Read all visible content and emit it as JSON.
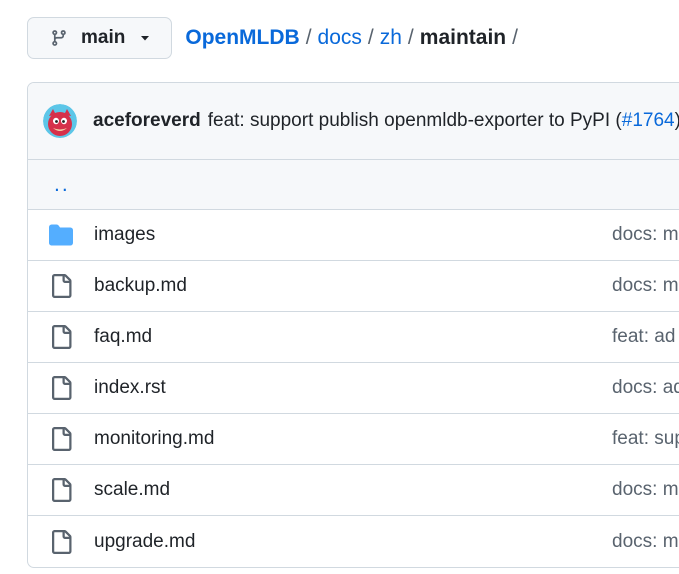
{
  "branch": {
    "label": "main",
    "icon": "git-branch-icon"
  },
  "breadcrumb": {
    "repo": "OpenMLDB",
    "sep1": "/",
    "part1": "docs",
    "sep2": "/",
    "part2": "zh",
    "sep3": "/",
    "current": "maintain",
    "sep4": "/"
  },
  "commit": {
    "author": "aceforeverd",
    "message": "feat: support publish openmldb-exporter to PyPI (",
    "pr": "#1764",
    "message_end": ")"
  },
  "parent_link": "..",
  "files": [
    {
      "name": "images",
      "type": "folder",
      "commit": "docs: m"
    },
    {
      "name": "backup.md",
      "type": "file",
      "commit": "docs: m"
    },
    {
      "name": "faq.md",
      "type": "file",
      "commit": "feat: ad"
    },
    {
      "name": "index.rst",
      "type": "file",
      "commit": "docs: ad"
    },
    {
      "name": "monitoring.md",
      "type": "file",
      "commit": "feat: sup"
    },
    {
      "name": "scale.md",
      "type": "file",
      "commit": "docs: m"
    },
    {
      "name": "upgrade.md",
      "type": "file",
      "commit": "docs: m"
    }
  ],
  "colors": {
    "link": "#0969da",
    "folder": "#54aeff",
    "muted": "#59636e",
    "border": "#d1d9e0"
  }
}
